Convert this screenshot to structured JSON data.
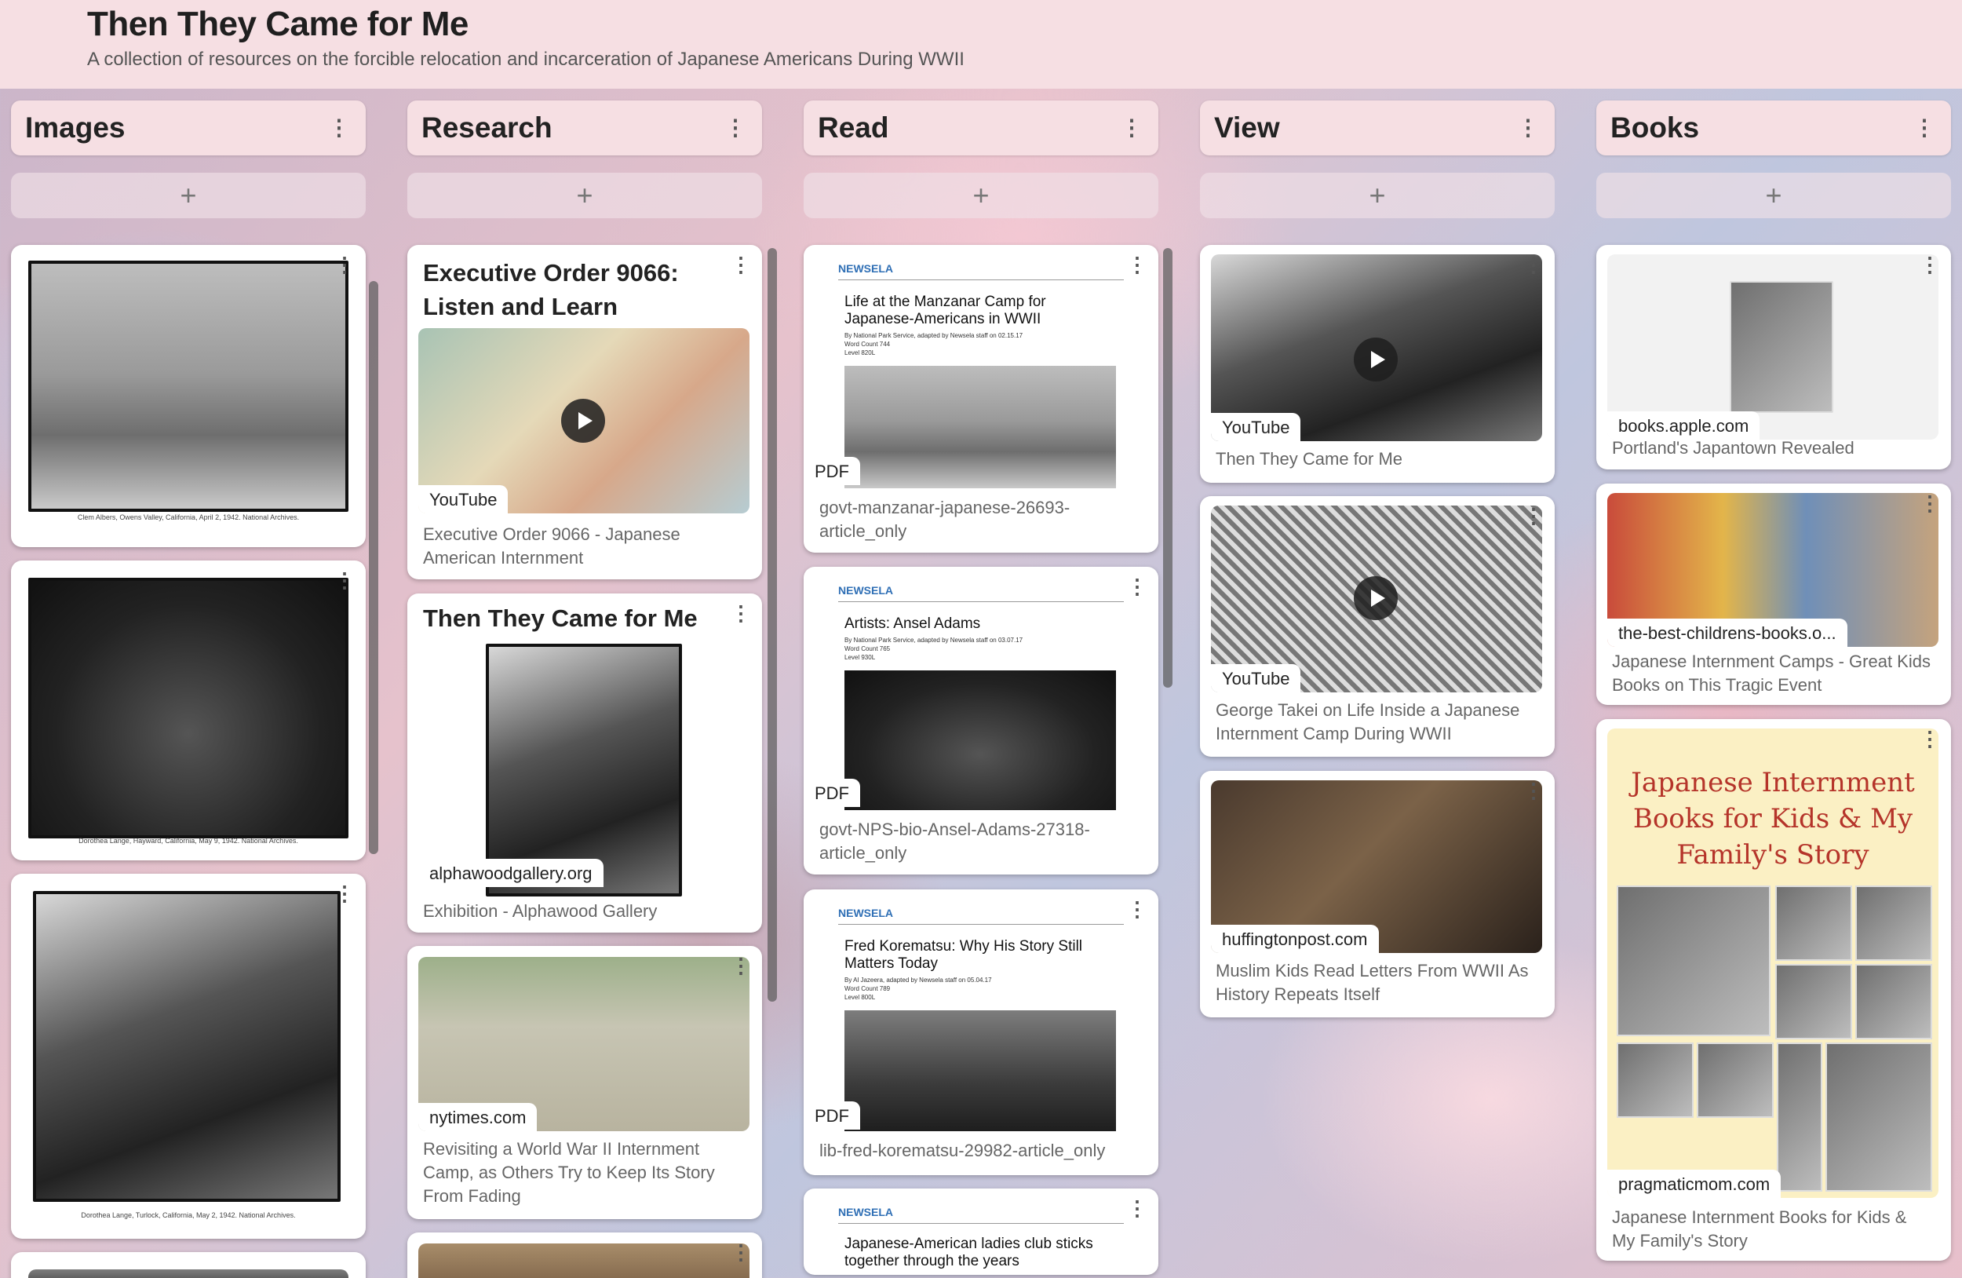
{
  "board": {
    "title": "Then They Came for Me",
    "subtitle": "A collection of resources on the forcible relocation and incarceration of Japanese Americans During WWII"
  },
  "ui": {
    "kebab": "⋮",
    "add": "+"
  },
  "columns": [
    {
      "title": "Images",
      "cards": [
        {
          "caption": "Clem Albers, Owens Valley, California, April 2, 1942. National Archives."
        },
        {
          "caption": "Dorothea Lange, Hayward, California, May 9, 1942. National Archives."
        },
        {
          "caption": "Dorothea Lange, Turlock, California, May 2, 1942. National Archives."
        }
      ]
    },
    {
      "title": "Research",
      "cards": [
        {
          "title": "Executive Order 9066: Listen and Learn",
          "source": "YouTube",
          "description": "Executive Order 9066 - Japanese American Internment"
        },
        {
          "title": "Then They Came for Me",
          "source": "alphawoodgallery.org",
          "description": "Exhibition - Alphawood Gallery"
        },
        {
          "source": "nytimes.com",
          "description": "Revisiting a World War II Internment Camp, as Others Try to Keep Its Story From Fading"
        }
      ]
    },
    {
      "title": "Read",
      "cards": [
        {
          "publisher": "NEWSELA",
          "doc_title": "Life at the Manzanar Camp for Japanese-Americans in WWII",
          "doc_meta": [
            "By National Park Service, adapted by Newsela staff on 02.15.17",
            "Word Count 744",
            "Level 820L"
          ],
          "source": "PDF",
          "description": "govt-manzanar-japanese-26693-article_only"
        },
        {
          "publisher": "NEWSELA",
          "doc_title": "Artists: Ansel Adams",
          "doc_meta": [
            "By National Park Service, adapted by Newsela staff on 03.07.17",
            "Word Count 765",
            "Level 930L"
          ],
          "source": "PDF",
          "description": "govt-NPS-bio-Ansel-Adams-27318-article_only"
        },
        {
          "publisher": "NEWSELA",
          "doc_title": "Fred Korematsu: Why His Story Still Matters Today",
          "doc_meta": [
            "By Al Jazeera, adapted by Newsela staff on 05.04.17",
            "Word Count 789",
            "Level 800L"
          ],
          "source": "PDF",
          "description": "lib-fred-korematsu-29982-article_only"
        },
        {
          "publisher": "NEWSELA",
          "doc_title": "Japanese-American ladies club sticks together through the years"
        }
      ]
    },
    {
      "title": "View",
      "cards": [
        {
          "source": "YouTube",
          "description": "Then They Came for Me"
        },
        {
          "source": "YouTube",
          "description": "George Takei on Life Inside a Japanese Internment Camp During WWII"
        },
        {
          "source": "huffingtonpost.com",
          "description": "Muslim Kids Read Letters From WWII As History Repeats Itself"
        }
      ]
    },
    {
      "title": "Books",
      "cards": [
        {
          "source": "books.apple.com",
          "description": "Portland's Japantown Revealed"
        },
        {
          "source": "the-best-childrens-books.o...",
          "description": "Japanese Internment Camps - Great Kids Books on This Tragic Event"
        },
        {
          "poster_title": "Japanese Internment Books for Kids & My Family's Story",
          "source": "pragmaticmom.com",
          "description": "Japanese Internment Books for Kids & My Family's Story"
        }
      ]
    }
  ]
}
